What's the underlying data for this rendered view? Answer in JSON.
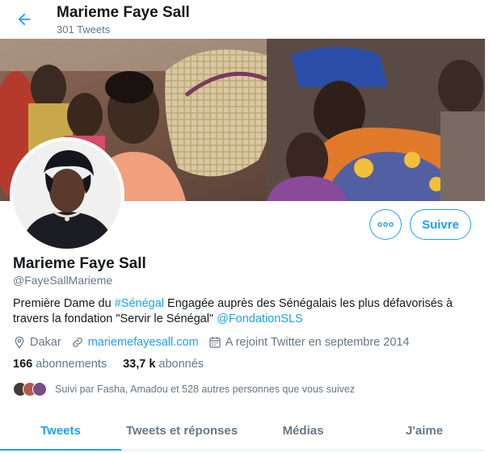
{
  "header": {
    "title": "Marieme Faye Sall",
    "tweet_count": "301 Tweets",
    "back_icon": "arrow-left-icon"
  },
  "profile": {
    "name": "Marieme Faye Sall",
    "handle": "@FayeSallMarieme",
    "follow_label": "Suivre",
    "more_icon": "more-horizontal-icon",
    "bio": {
      "part1": "Première Dame du ",
      "hashtag": "#Sénégal",
      "part2": "  Engagée auprès des Sénégalais les plus défavorisés à travers la fondation \"Servir le Sénégal\" ",
      "mention": "@FondationSLS"
    },
    "location": "Dakar",
    "website": "mariemefayesall.com",
    "joined": "A rejoint Twitter en septembre 2014",
    "following_count": "166",
    "following_label": "abonnements",
    "followers_count": "33,7 k",
    "followers_label": "abonnés",
    "followed_by": "Suivi par Fasha, Amadou et 528 autres personnes que vous suivez"
  },
  "tabs": [
    {
      "label": "Tweets",
      "active": true
    },
    {
      "label": "Tweets et réponses",
      "active": false
    },
    {
      "label": "Médias",
      "active": false
    },
    {
      "label": "J'aime",
      "active": false
    }
  ],
  "colors": {
    "accent": "#1da1f2",
    "text": "#14171a",
    "muted": "#657786"
  }
}
